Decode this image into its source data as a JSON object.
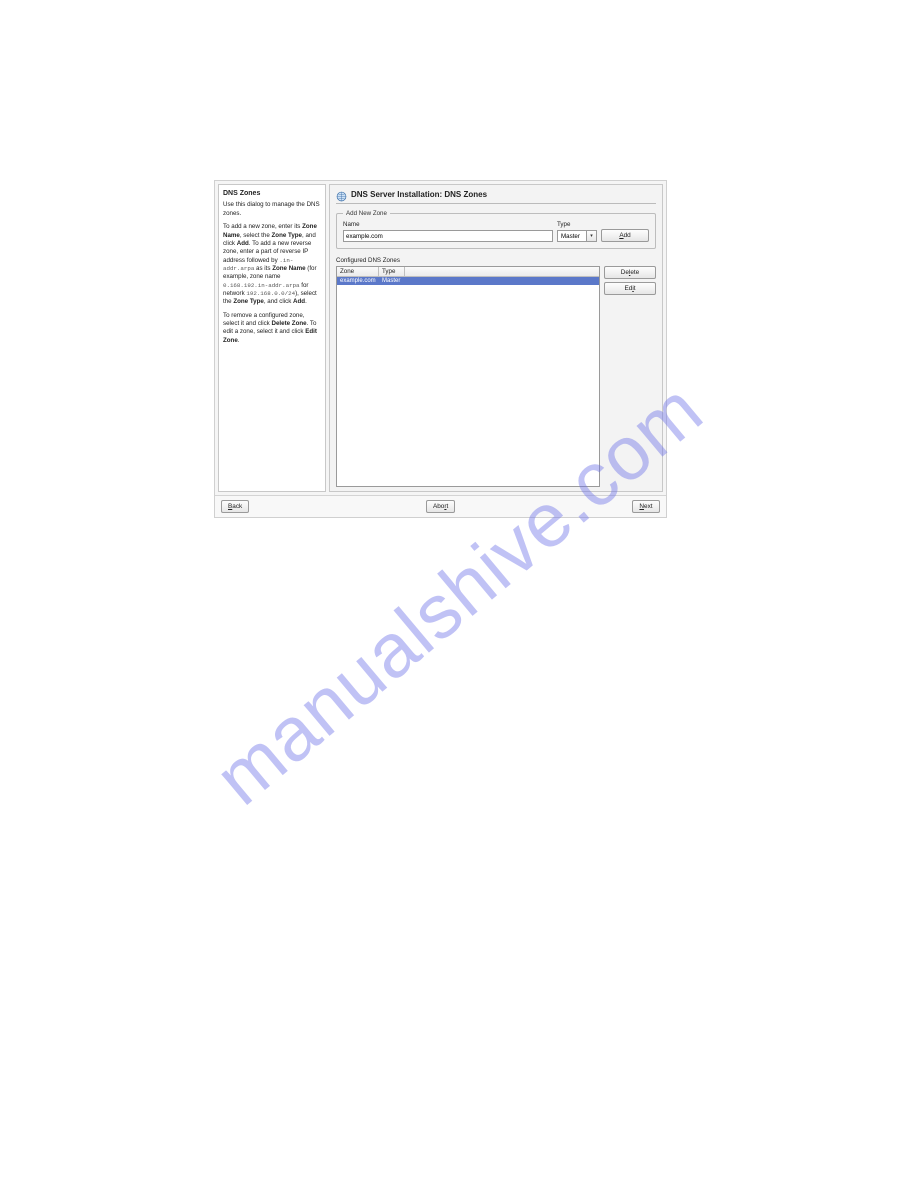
{
  "watermark": "manualshive.com",
  "help": {
    "title": "DNS Zones",
    "intro": "Use this dialog to manage the DNS zones.",
    "add1_a": "To add a new zone, enter its ",
    "add1_b": "Zone Name",
    "add1_c": ", select the ",
    "add1_d": "Zone Type",
    "add1_e": ", and click ",
    "add1_f": "Add",
    "add1_g": ". To add a new reverse zone, enter a part of reverse IP address followed by ",
    "add1_code1": ".in-addr.arpa",
    "add1_h": " as its ",
    "add1_i": "Zone Name",
    "add1_j": " (for example, zone name ",
    "add1_code2": "0.168.192.in-addr.arpa",
    "add1_k": " for network ",
    "add1_code3": "192.168.0.0/24",
    "add1_l": "), select the ",
    "add1_m": "Zone Type",
    "add1_n": ", and click ",
    "add1_o": "Add",
    "add1_p": ".",
    "rem_a": "To remove a configured zone, select it and click ",
    "rem_b": "Delete Zone",
    "rem_c": ". To edit a zone, select it and click ",
    "rem_d": "Edit Zone",
    "rem_e": "."
  },
  "main": {
    "title": "DNS Server Installation: DNS Zones",
    "legend": "Add New Zone",
    "name_label": "Name",
    "name_value": "example.com",
    "type_label": "Type",
    "type_value": "Master",
    "add_button_pre": "A",
    "add_button_rest": "dd",
    "group_label": "Configured DNS Zones",
    "col_zone": "Zone",
    "col_type": "Type",
    "rows": [
      {
        "zone": "example.com",
        "type": "Master"
      }
    ],
    "delete_pre": "De",
    "delete_u": "l",
    "delete_post": "ete",
    "edit_pre": "Ed",
    "edit_u": "i",
    "edit_post": "t"
  },
  "footer": {
    "back_u": "B",
    "back_rest": "ack",
    "abort_pre": "Abo",
    "abort_u": "r",
    "abort_post": "t",
    "next_u": "N",
    "next_rest": "ext"
  }
}
